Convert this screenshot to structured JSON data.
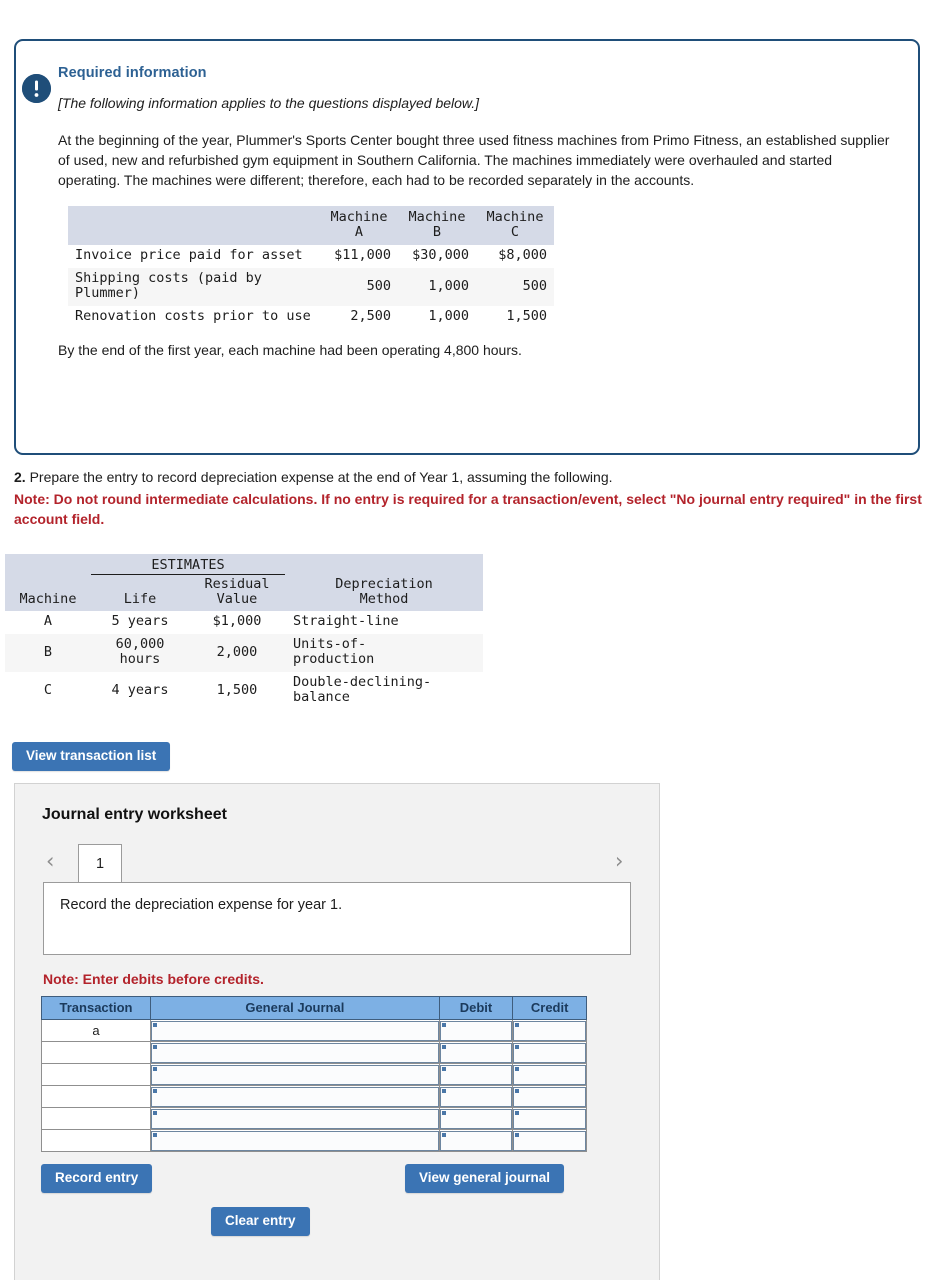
{
  "required_box": {
    "icon": "exclamation-circle-icon",
    "title": "Required information",
    "subtitle": "[The following information applies to the questions displayed below.]",
    "paragraph": "At the beginning of the year, Plummer's Sports Center bought three used fitness machines from Primo Fitness, an established supplier of used, new and refurbished gym equipment in Southern California. The machines immediately were overhauled and started operating. The machines were different; therefore, each had to be recorded separately in the accounts.",
    "footer": "By the end of the first year, each machine had been operating 4,800 hours.",
    "cost_table": {
      "headers": [
        "",
        "Machine A",
        "Machine B",
        "Machine C"
      ],
      "header_line1": [
        "",
        "Machine",
        "Machine",
        "Machine"
      ],
      "header_line2": [
        "",
        "A",
        "B",
        "C"
      ],
      "rows": [
        {
          "label": "Invoice price paid for asset",
          "a": "$11,000",
          "b": "$30,000",
          "c": "$8,000"
        },
        {
          "label": "Shipping costs (paid by Plummer)",
          "a": "500",
          "b": "1,000",
          "c": "500"
        },
        {
          "label": "Renovation costs prior to use",
          "a": "2,500",
          "b": "1,000",
          "c": "1,500"
        }
      ]
    }
  },
  "question": {
    "number": "2.",
    "text": " Prepare the entry to record depreciation expense at the end of Year 1, assuming the following.",
    "note": "Note: Do not round intermediate calculations. If no entry is required for a transaction/event, select \"No journal entry required\" in the first account field."
  },
  "estimates_table": {
    "group_header": "ESTIMATES",
    "headers": {
      "machine": "Machine",
      "life": "Life",
      "residual_line1": "Residual",
      "residual_line2": "Value",
      "method_line1": "Depreciation",
      "method_line2": "Method"
    },
    "rows": [
      {
        "machine": "A",
        "life": "5 years",
        "residual": "$1,000",
        "method": "Straight-line"
      },
      {
        "machine": "B",
        "life_line1": "60,000",
        "life_line2": "hours",
        "residual": "2,000",
        "method_line1": "Units-of-",
        "method_line2": "production"
      },
      {
        "machine": "C",
        "life": "4 years",
        "residual": "1,500",
        "method_line1": "Double-declining-",
        "method_line2": "balance"
      }
    ]
  },
  "buttons": {
    "view_transaction_list": "View transaction list",
    "record_entry": "Record entry",
    "clear_entry": "Clear entry",
    "view_general_journal": "View general journal"
  },
  "worksheet": {
    "title": "Journal entry worksheet",
    "pager": {
      "prev_icon": "chevron-left-icon",
      "next_icon": "chevron-right-icon",
      "current_tab": "1"
    },
    "description": "Record the depreciation expense for year 1.",
    "note": "Note: Enter debits before credits.",
    "journal_table": {
      "headers": [
        "Transaction",
        "General Journal",
        "Debit",
        "Credit"
      ],
      "rows": [
        {
          "transaction": "a",
          "general_journal": "",
          "debit": "",
          "credit": ""
        },
        {
          "transaction": "",
          "general_journal": "",
          "debit": "",
          "credit": ""
        },
        {
          "transaction": "",
          "general_journal": "",
          "debit": "",
          "credit": ""
        },
        {
          "transaction": "",
          "general_journal": "",
          "debit": "",
          "credit": ""
        },
        {
          "transaction": "",
          "general_journal": "",
          "debit": "",
          "credit": ""
        },
        {
          "transaction": "",
          "general_journal": "",
          "debit": "",
          "credit": ""
        }
      ]
    }
  },
  "colors": {
    "box_border": "#1f4e79",
    "icon_fill": "#1f4e79",
    "title_blue": "#2d6193",
    "note_red": "#b3232b",
    "button_blue": "#3b74b4",
    "table_header_gray_blue": "#d5dae7",
    "journal_header_blue": "#7db0e4",
    "panel_bg": "#f2f2f2"
  }
}
